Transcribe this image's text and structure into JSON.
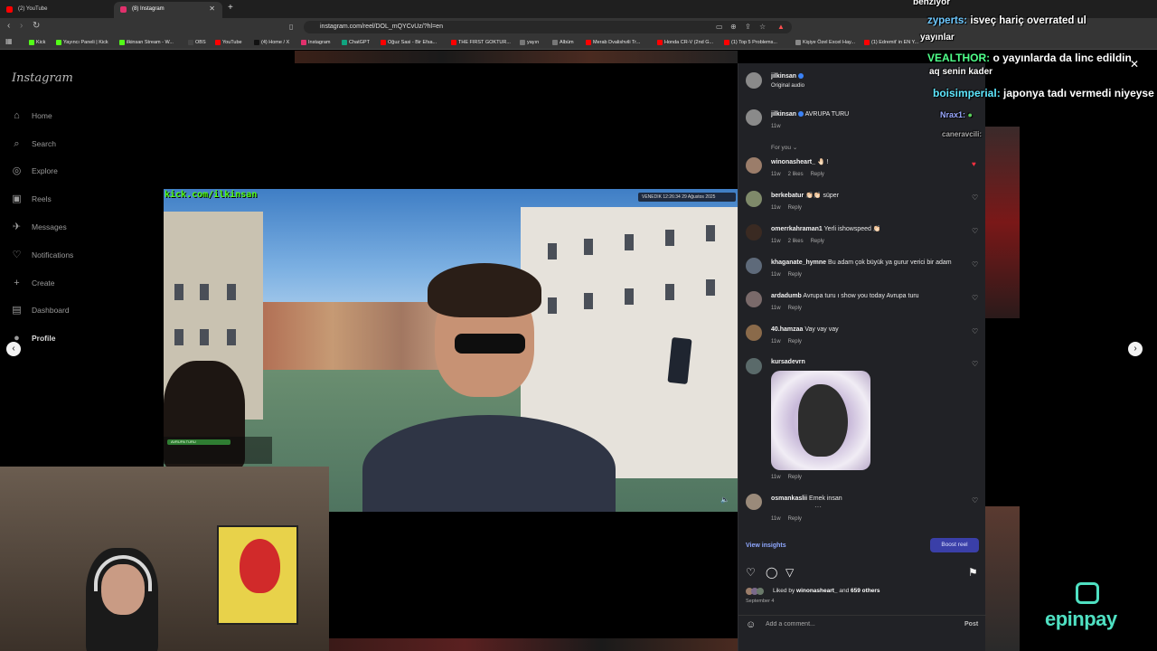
{
  "browser": {
    "tabs": [
      {
        "label": "(2) YouTube",
        "color": "#ff0000"
      },
      {
        "label": "(8) Instagram",
        "color": "#e1306c"
      }
    ],
    "url": "instagram.com/reel/DOL_mQYCvUz/?hl=en",
    "bookmarks": [
      {
        "label": "Kick",
        "color": "#53fc18"
      },
      {
        "label": "Yayıncı Paneli | Kick",
        "color": "#53fc18"
      },
      {
        "label": "ilkinsan Stream - W...",
        "color": "#53fc18"
      },
      {
        "label": "OBS",
        "color": "#444444"
      },
      {
        "label": "YouTube",
        "color": "#ff0000"
      },
      {
        "label": "(4) Home / X",
        "color": "#000000"
      },
      {
        "label": "Instagram",
        "color": "#e1306c"
      },
      {
        "label": "ChatGPT",
        "color": "#10a37f"
      },
      {
        "label": "Oğuz Sasi - Bir Efsa...",
        "color": "#ff0000"
      },
      {
        "label": "THE FIRST GOKTUR...",
        "color": "#ff0000"
      },
      {
        "label": "yayın",
        "color": "#777777"
      },
      {
        "label": "Albüm",
        "color": "#777777"
      },
      {
        "label": "Merab Dvalishvili Tr...",
        "color": "#ff0000"
      },
      {
        "label": "Honda CR-V (2nd G...",
        "color": "#ff0000"
      },
      {
        "label": "(1) Top 5 Problems...",
        "color": "#ff0000"
      },
      {
        "label": "Kişiye Özel Excel Hay...",
        "color": "#888888"
      },
      {
        "label": "(1) Edremit' in EN Y...",
        "color": "#ff0000"
      }
    ]
  },
  "sidebar": {
    "logo": "Instagram",
    "items": [
      {
        "label": "Home",
        "icon": "⌂"
      },
      {
        "label": "Search",
        "icon": "⌕"
      },
      {
        "label": "Explore",
        "icon": "◎"
      },
      {
        "label": "Reels",
        "icon": "▣"
      },
      {
        "label": "Messages",
        "icon": "✈"
      },
      {
        "label": "Notifications",
        "icon": "♡"
      },
      {
        "label": "Create",
        "icon": "+"
      },
      {
        "label": "Dashboard",
        "icon": "▤"
      },
      {
        "label": "Profile",
        "icon": "●"
      }
    ]
  },
  "video": {
    "kick_overlay": "kick.com/ilkinsan",
    "stream_badge": "VENEDIK  12:26:34  29 Ağustos 2025",
    "mini_overlay": "AVRUPA TURU"
  },
  "post": {
    "author": "jilkinsan",
    "audio": "Original audio",
    "caption_user": "jilkinsan",
    "caption_text": "AVRUPA TURU",
    "caption_age": "11w",
    "for_you": "For you ⌄",
    "comments": [
      {
        "user": "winonasheart_",
        "text": "🤚🏻 !",
        "age": "11w",
        "likes": "2 likes",
        "reply": "Reply",
        "liked": true
      },
      {
        "user": "berkebatur",
        "text": "👏🏻👏🏻 süper",
        "age": "11w",
        "likes": "",
        "reply": "Reply",
        "liked": false
      },
      {
        "user": "omerrkahraman1",
        "text": "Yerli ishowspeed 👏🏻",
        "age": "11w",
        "likes": "2 likes",
        "reply": "Reply",
        "liked": false
      },
      {
        "user": "khaganate_hymne",
        "text": "Bu adam çok büyük ya gurur verici bir adam",
        "age": "11w",
        "likes": "",
        "reply": "Reply",
        "liked": false
      },
      {
        "user": "ardadumb",
        "text": "Avrupa turu ı show you today Avrupa turu",
        "age": "11w",
        "likes": "",
        "reply": "Reply",
        "liked": false
      },
      {
        "user": "40.hamzaa",
        "text": "Vay vay vay",
        "age": "11w",
        "likes": "",
        "reply": "Reply",
        "liked": false
      },
      {
        "user": "kursadevrn",
        "text": "",
        "age": "11w",
        "likes": "",
        "reply": "Reply",
        "liked": false
      },
      {
        "user": "osmankaslii",
        "text": "Emek insan",
        "age": "11w",
        "likes": "",
        "reply": "Reply",
        "liked": false
      }
    ],
    "view_insights": "View insights",
    "boost": "Boost reel",
    "liked_by_prefix": "Liked by",
    "liked_by_user": "winonasheart_",
    "liked_by_suffix": "and",
    "liked_by_others": "659 others",
    "date": "September 4",
    "comment_placeholder": "Add a comment...",
    "post_label": "Post"
  },
  "chat": [
    {
      "text": "benziyor"
    },
    {
      "name": "zyperts:",
      "text": "isveç hariç overrated ul",
      "color": "#6ec8ff"
    },
    {
      "text": "yayınlar"
    },
    {
      "name": "VEALTHOR:",
      "text": "o yayınlarda da linc edildin",
      "color": "#4fff8a"
    },
    {
      "text": "aq senin kader"
    },
    {
      "name": "boisimperial:",
      "text": "japonya tadı vermedi niyeyse",
      "color": "#5fe8ff"
    },
    {
      "name": "Nrax1:",
      "text": "",
      "color": "#9aa8ff"
    },
    {
      "name": "caneravcili:",
      "text": "",
      "color": "#aaaaaa"
    }
  ],
  "sponsor": "epinpay"
}
